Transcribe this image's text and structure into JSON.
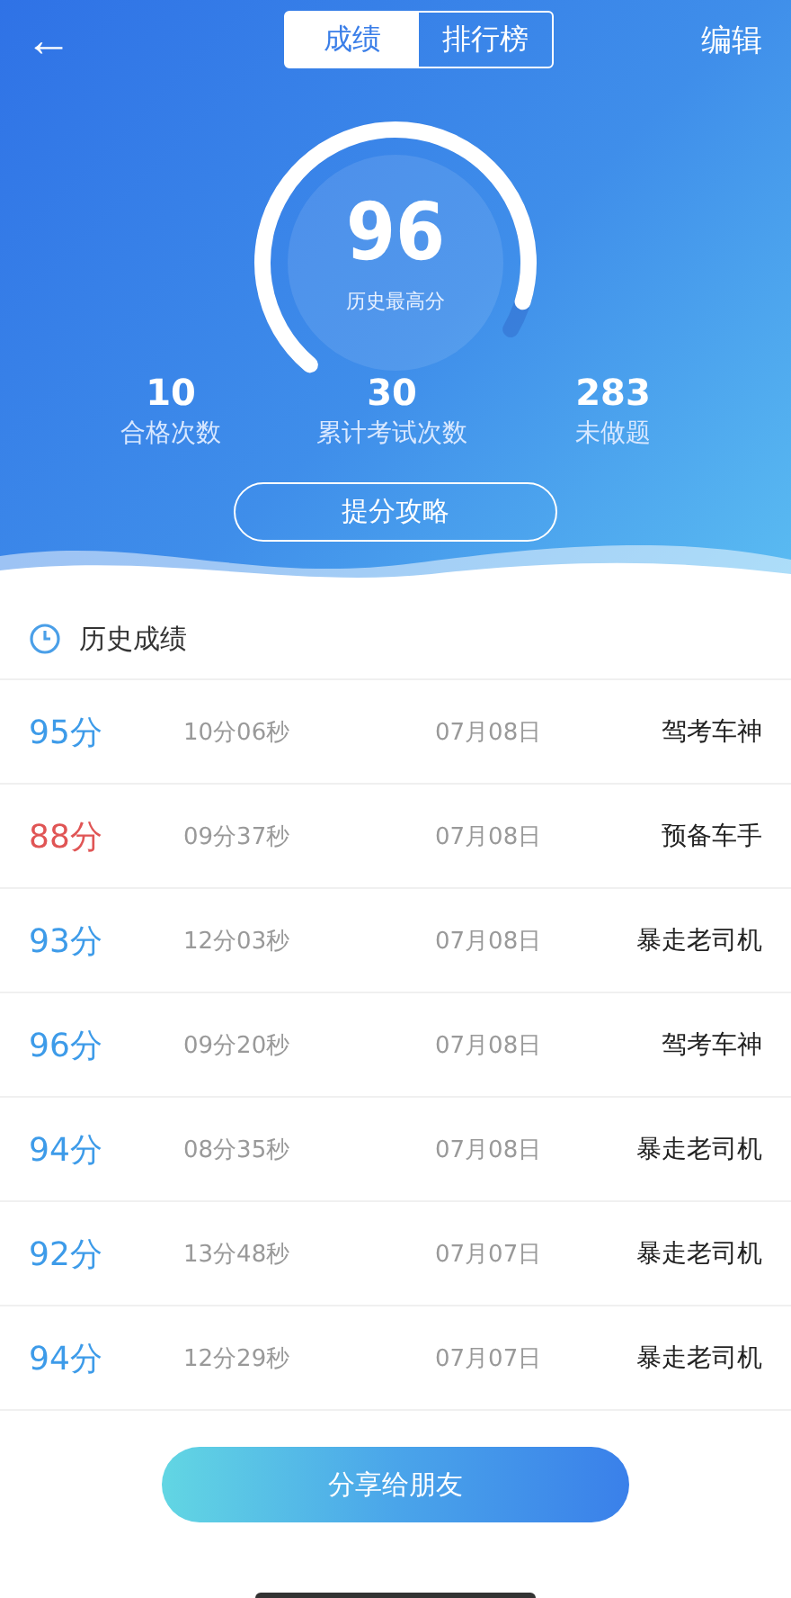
{
  "nav": {
    "back": "←",
    "tabs": [
      {
        "label": "成绩",
        "selected": true
      },
      {
        "label": "排行榜",
        "selected": false
      }
    ],
    "edit": "编辑"
  },
  "gauge": {
    "score": "96",
    "caption": "历史最高分"
  },
  "stats": [
    {
      "value": "10",
      "label": "合格次数"
    },
    {
      "value": "30",
      "label": "累计考试次数"
    },
    {
      "value": "283",
      "label": "未做题"
    }
  ],
  "tips_button": "提分攻略",
  "history": {
    "title": "历史成绩",
    "rows": [
      {
        "score": "95分",
        "passed": true,
        "duration": "10分06秒",
        "date": "07月08日",
        "rank": "驾考车神"
      },
      {
        "score": "88分",
        "passed": false,
        "duration": "09分37秒",
        "date": "07月08日",
        "rank": "预备车手"
      },
      {
        "score": "93分",
        "passed": true,
        "duration": "12分03秒",
        "date": "07月08日",
        "rank": "暴走老司机"
      },
      {
        "score": "96分",
        "passed": true,
        "duration": "09分20秒",
        "date": "07月08日",
        "rank": "驾考车神"
      },
      {
        "score": "94分",
        "passed": true,
        "duration": "08分35秒",
        "date": "07月08日",
        "rank": "暴走老司机"
      },
      {
        "score": "92分",
        "passed": true,
        "duration": "13分48秒",
        "date": "07月07日",
        "rank": "暴走老司机"
      },
      {
        "score": "94分",
        "passed": true,
        "duration": "12分29秒",
        "date": "07月07日",
        "rank": "暴走老司机"
      }
    ]
  },
  "share_button": "分享给朋友"
}
